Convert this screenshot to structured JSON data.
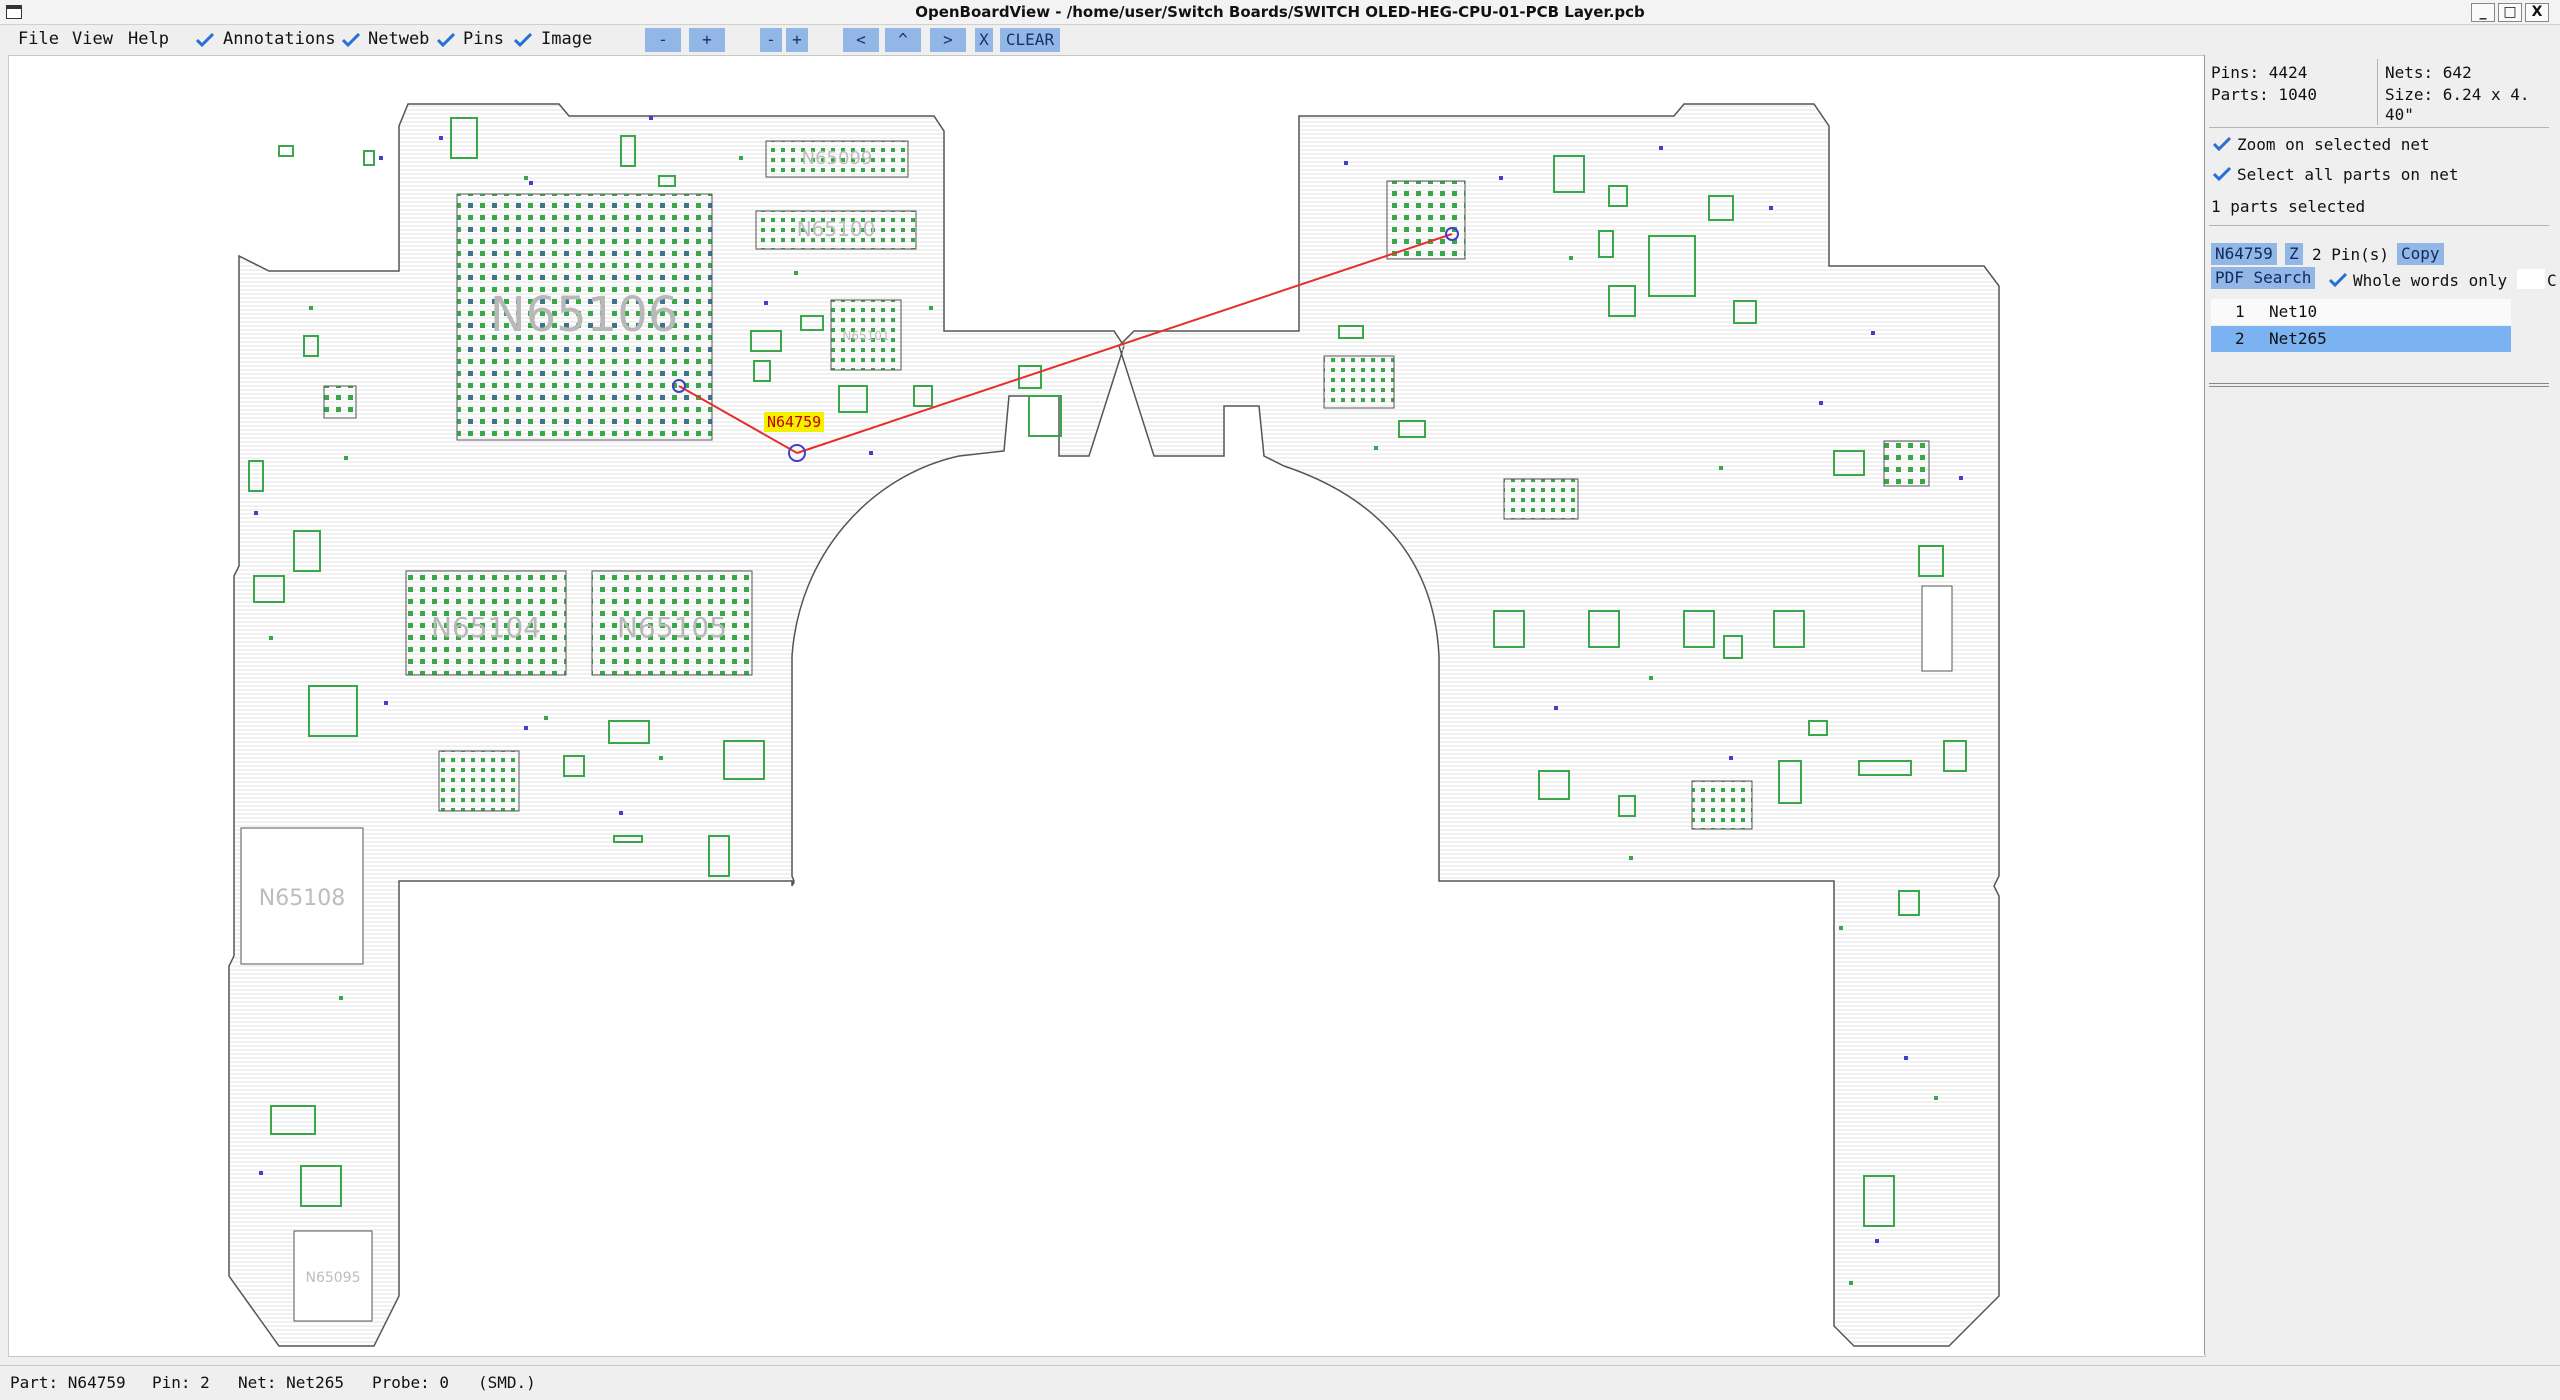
{
  "window": {
    "title": "OpenBoardView - /home/user/Switch Boards/SWITCH OLED-HEG-CPU-01-PCB Layer.pcb",
    "minimize": "_",
    "maximize": "□",
    "close": "X"
  },
  "menu": {
    "file": "File",
    "view": "View",
    "help": "Help"
  },
  "toolbar": {
    "annotations": "Annotations",
    "netweb": "Netweb",
    "pins": "Pins",
    "image": "Image",
    "zoom_out": "-",
    "zoom_in": "+",
    "zoom_out2": "-",
    "zoom_in2": "+",
    "left": "<",
    "up": "^",
    "right": ">",
    "x": "X",
    "clear": "CLEAR"
  },
  "board": {
    "selected_part": "N64759",
    "component_labels": [
      "N65106",
      "N65099",
      "N65100",
      "N65104",
      "N65105",
      "N65108",
      "N65095"
    ],
    "colors": {
      "outline": "#555555",
      "pad_green": "#3aa84a",
      "pad_blue": "#4040c8",
      "net_line": "#e53030",
      "selected_label_bg": "#f5f000"
    }
  },
  "panel": {
    "pins": "Pins: 4424",
    "nets": "Nets: 642",
    "parts": "Parts: 1040",
    "size": "Size: 6.24 x 4.",
    "size2": "40\"",
    "zoom_on_net": "Zoom on selected net",
    "select_all_parts": "Select all parts on net",
    "parts_selected": "1 parts selected",
    "part_button": "N64759",
    "z_button": "Z",
    "pin_count": "2 Pin(s)",
    "copy": "Copy",
    "pdf_search": "PDF Search",
    "whole_words": "Whole words only",
    "cut": "C",
    "nets_list": [
      {
        "num": "1",
        "name": "Net10"
      },
      {
        "num": "2",
        "name": "Net265"
      }
    ]
  },
  "status": {
    "part": "Part: N64759",
    "pin": "Pin: 2",
    "net": "Net: Net265",
    "probe": "Probe: 0",
    "type": "(SMD.)"
  }
}
